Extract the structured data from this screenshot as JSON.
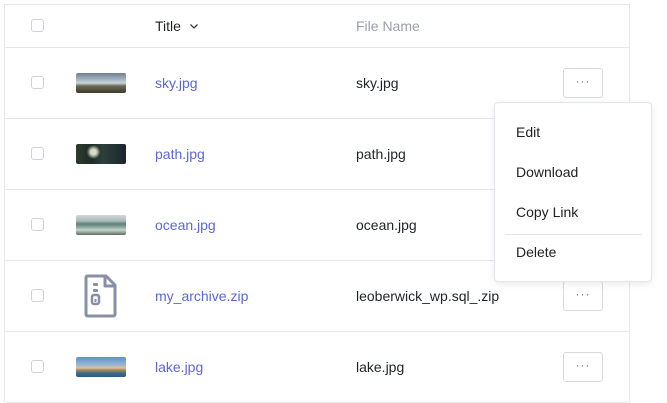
{
  "header": {
    "title_label": "Title",
    "file_name_label": "File Name"
  },
  "rows": [
    {
      "title": "sky.jpg",
      "file_name": "sky.jpg",
      "thumb": "sky-image"
    },
    {
      "title": "path.jpg",
      "file_name": "path.jpg",
      "thumb": "path-image"
    },
    {
      "title": "ocean.jpg",
      "file_name": "ocean.jpg",
      "thumb": "ocean-image"
    },
    {
      "title": "my_archive.zip",
      "file_name": "leoberwick_wp.sql_.zip",
      "thumb": "document-zip-icon"
    },
    {
      "title": "lake.jpg",
      "file_name": "lake.jpg",
      "thumb": "lake-image"
    }
  ],
  "more_button_label": "···",
  "menu": {
    "edit": "Edit",
    "download": "Download",
    "copy_link": "Copy Link",
    "delete": "Delete"
  },
  "colors": {
    "link": "#5b67d6",
    "border": "#e6e7ec",
    "muted_header": "#9aa0ab"
  }
}
